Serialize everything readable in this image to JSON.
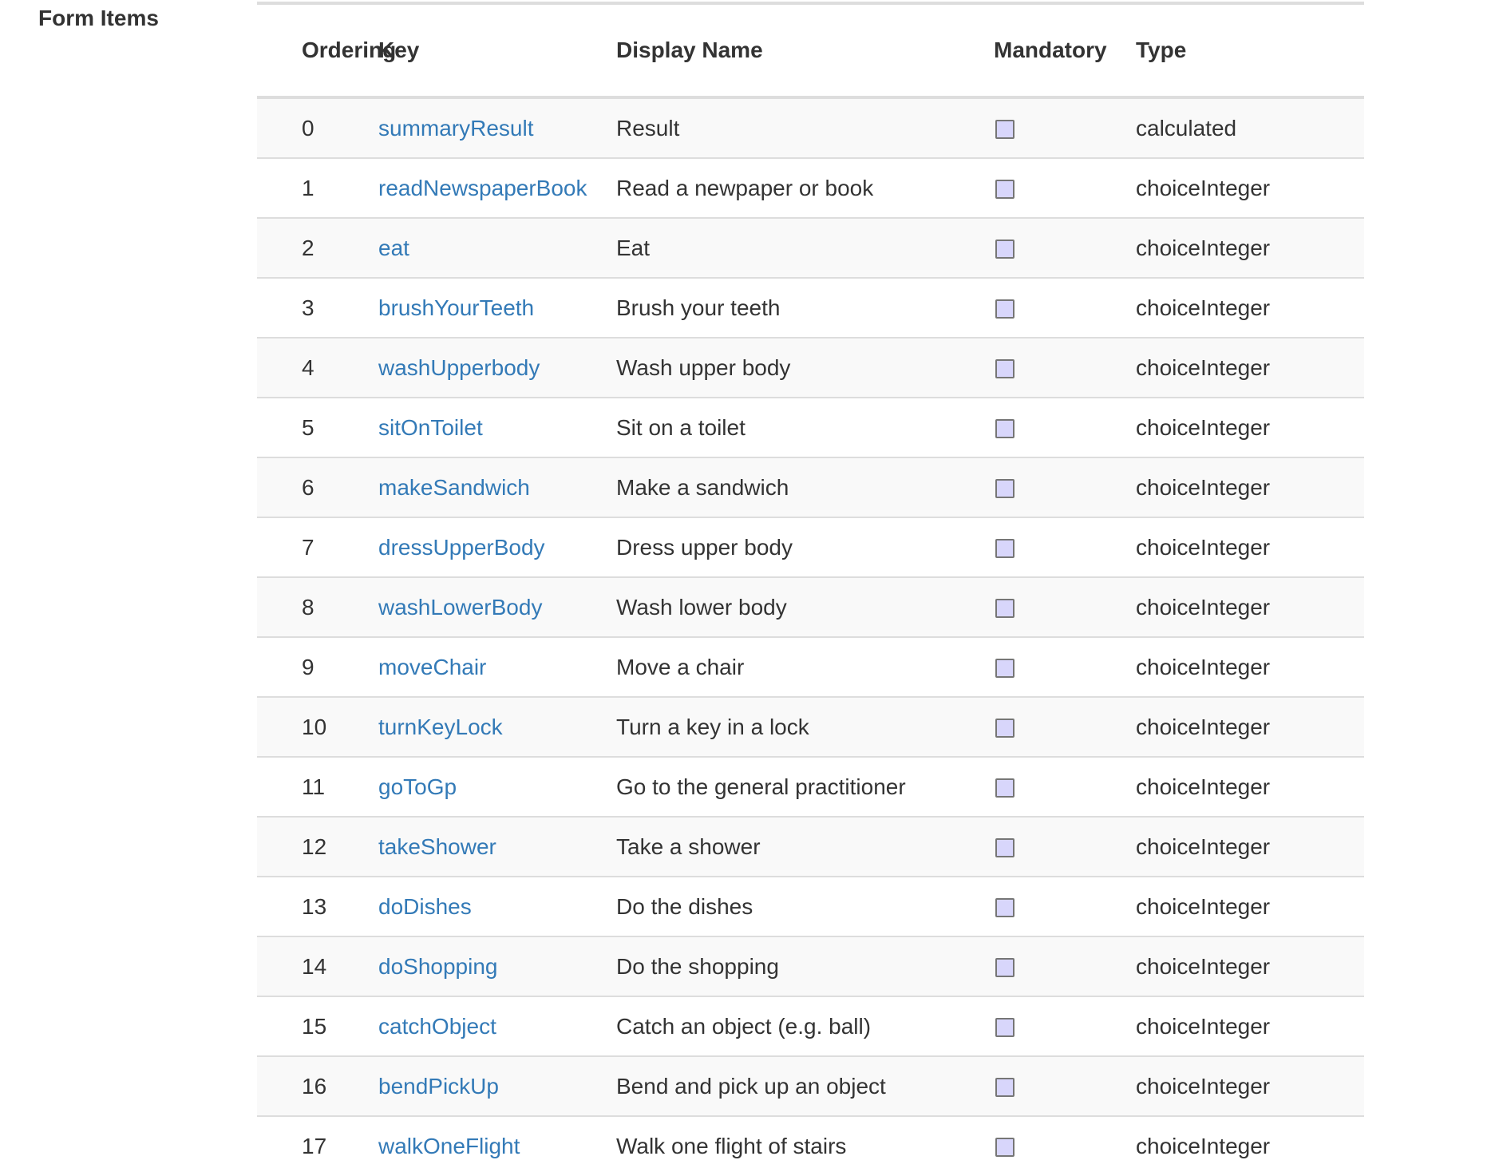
{
  "section": {
    "label": "Form Items"
  },
  "table": {
    "headers": {
      "ordering": "Ordering",
      "key": "Key",
      "display_name": "Display Name",
      "mandatory": "Mandatory",
      "type": "Type"
    },
    "rows": [
      {
        "ordering": "0",
        "key": "summaryResult",
        "display_name": "Result",
        "mandatory": false,
        "type": "calculated"
      },
      {
        "ordering": "1",
        "key": "readNewspaperBook",
        "display_name": "Read a newpaper or book",
        "mandatory": false,
        "type": "choiceInteger"
      },
      {
        "ordering": "2",
        "key": "eat",
        "display_name": "Eat",
        "mandatory": false,
        "type": "choiceInteger"
      },
      {
        "ordering": "3",
        "key": "brushYourTeeth",
        "display_name": "Brush your teeth",
        "mandatory": false,
        "type": "choiceInteger"
      },
      {
        "ordering": "4",
        "key": "washUpperbody",
        "display_name": "Wash upper body",
        "mandatory": false,
        "type": "choiceInteger"
      },
      {
        "ordering": "5",
        "key": "sitOnToilet",
        "display_name": "Sit on a toilet",
        "mandatory": false,
        "type": "choiceInteger"
      },
      {
        "ordering": "6",
        "key": "makeSandwich",
        "display_name": "Make a sandwich",
        "mandatory": false,
        "type": "choiceInteger"
      },
      {
        "ordering": "7",
        "key": "dressUpperBody",
        "display_name": "Dress upper body",
        "mandatory": false,
        "type": "choiceInteger"
      },
      {
        "ordering": "8",
        "key": "washLowerBody",
        "display_name": "Wash lower body",
        "mandatory": false,
        "type": "choiceInteger"
      },
      {
        "ordering": "9",
        "key": "moveChair",
        "display_name": "Move a chair",
        "mandatory": false,
        "type": "choiceInteger"
      },
      {
        "ordering": "10",
        "key": "turnKeyLock",
        "display_name": "Turn a key in a lock",
        "mandatory": false,
        "type": "choiceInteger"
      },
      {
        "ordering": "11",
        "key": "goToGp",
        "display_name": "Go to the general practitioner",
        "mandatory": false,
        "type": "choiceInteger"
      },
      {
        "ordering": "12",
        "key": "takeShower",
        "display_name": "Take a shower",
        "mandatory": false,
        "type": "choiceInteger"
      },
      {
        "ordering": "13",
        "key": "doDishes",
        "display_name": "Do the dishes",
        "mandatory": false,
        "type": "choiceInteger"
      },
      {
        "ordering": "14",
        "key": "doShopping",
        "display_name": "Do the shopping",
        "mandatory": false,
        "type": "choiceInteger"
      },
      {
        "ordering": "15",
        "key": "catchObject",
        "display_name": "Catch an object (e.g. ball)",
        "mandatory": false,
        "type": "choiceInteger"
      },
      {
        "ordering": "16",
        "key": "bendPickUp",
        "display_name": "Bend and pick up an object",
        "mandatory": false,
        "type": "choiceInteger"
      },
      {
        "ordering": "17",
        "key": "walkOneFlight",
        "display_name": "Walk one flight of stairs",
        "mandatory": false,
        "type": "choiceInteger"
      }
    ]
  },
  "colors": {
    "link": "#337ab7",
    "text": "#333333",
    "border": "#dddddd",
    "stripe": "#f9f9f9",
    "checkbox_fill": "#d8d6fb"
  }
}
